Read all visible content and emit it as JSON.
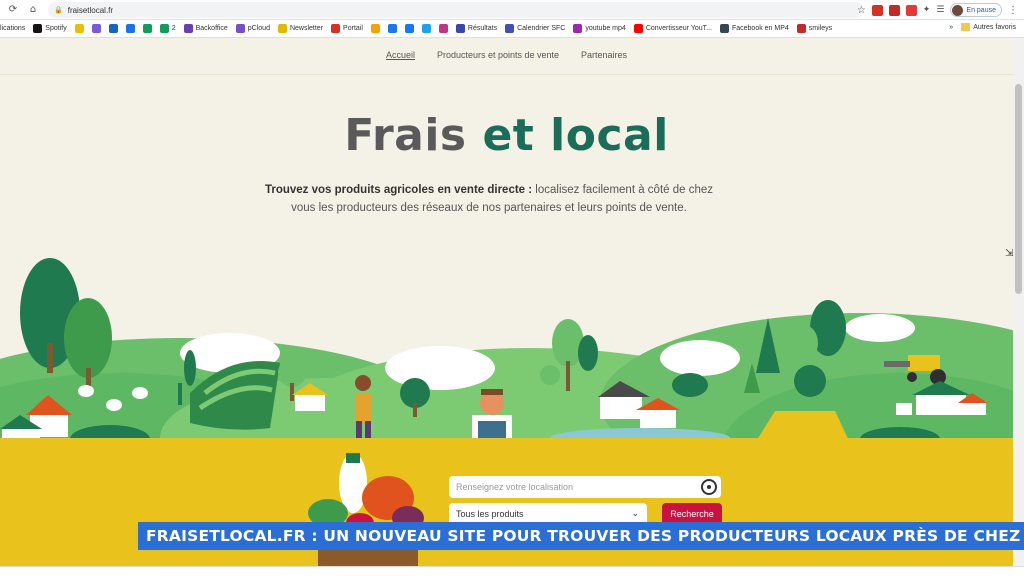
{
  "browser": {
    "url": "fraisetlocal.fr",
    "profile_status": "En pause",
    "bookmarks": [
      {
        "label": "lications",
        "color": "#888888"
      },
      {
        "label": "Spotify",
        "color": "#191414"
      },
      {
        "label": "",
        "color": "#e8c000"
      },
      {
        "label": "",
        "color": "#7b5cd6"
      },
      {
        "label": "",
        "color": "#1565c0"
      },
      {
        "label": "",
        "color": "#1a73e8"
      },
      {
        "label": "",
        "color": "#0f9d58"
      },
      {
        "label": "2",
        "color": "#0f9d58"
      },
      {
        "label": "Backoffice",
        "color": "#6a3fb3"
      },
      {
        "label": "pCloud",
        "color": "#7a4dc9"
      },
      {
        "label": "Newsletter",
        "color": "#e5b800"
      },
      {
        "label": "Portail",
        "color": "#d93025"
      },
      {
        "label": "",
        "color": "#f4a300"
      },
      {
        "label": "",
        "color": "#1877f2"
      },
      {
        "label": "",
        "color": "#1877f2"
      },
      {
        "label": "",
        "color": "#1da1f2"
      },
      {
        "label": "",
        "color": "#c13584"
      },
      {
        "label": "Résultats",
        "color": "#3949ab"
      },
      {
        "label": "Calendrier SFC",
        "color": "#3f51b5"
      },
      {
        "label": "youtube mp4",
        "color": "#9c27b0"
      },
      {
        "label": "Convertisseur YouT...",
        "color": "#ff0000"
      },
      {
        "label": "Facebook en MP4",
        "color": "#37474f"
      },
      {
        "label": "smileys",
        "color": "#c62828"
      }
    ],
    "more_bookmarks": "»",
    "other_bookmarks": "Autres favoris"
  },
  "site": {
    "nav": {
      "home": "Accueil",
      "producers": "Producteurs et points de vente",
      "partners": "Partenaires"
    },
    "hero": {
      "title_part1": "Frais",
      "title_part2": "et local",
      "subtitle_bold": "Trouvez vos produits agricoles en vente directe :",
      "subtitle_rest": " localisez facilement à côté de chez vous les producteurs des réseaux de nos partenaires et leurs points de vente."
    },
    "search": {
      "location_placeholder": "Renseignez votre localisation",
      "products_select": "Tous les produits",
      "search_button": "Recherche"
    }
  },
  "ticker": {
    "text": "FRAISETLOCAL.FR : UN NOUVEAU SITE POUR TROUVER DES PRODUCTEURS LOCAUX PRÈS DE CHEZ VOUS"
  },
  "colors": {
    "title_gray": "#5a5a5a",
    "title_green": "#1b6d5a",
    "band_yellow": "#e9c21c",
    "button_red": "#c9123f",
    "ticker_blue": "#2b6fd6"
  }
}
